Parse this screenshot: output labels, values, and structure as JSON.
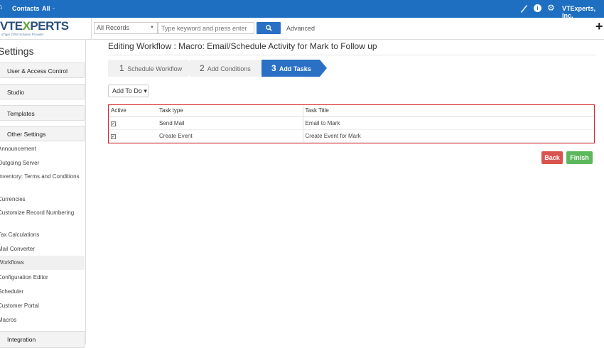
{
  "topbar": {
    "contacts": "Contacts",
    "all": "All",
    "org": "VTExperts, Inc."
  },
  "logo": {
    "brand_a": "VTE",
    "brand_x": "X",
    "brand_b": "PERTS",
    "tagline": "vTiger CRM Solution Provider"
  },
  "search": {
    "record_type": "All Records",
    "placeholder": "Type keyword and press enter",
    "advanced": "Advanced"
  },
  "sidebar": {
    "title": "Settings",
    "user_access": "User & Access Control",
    "studio": "Studio",
    "templates": "Templates",
    "other_settings": "Other Settings",
    "items": [
      "Announcement",
      "Outgoing Server",
      "Inventory: Terms and Conditions",
      "Currencies",
      "Customize Record Numbering",
      "Tax Calculations",
      "Mail Converter",
      "Workflows",
      "Configuration Editor",
      "Scheduler",
      "Customer Portal",
      "Macros"
    ],
    "integration": "Integration"
  },
  "main": {
    "page_title": "Editing Workflow : Macro: Email/Schedule Activity for Mark to Follow up",
    "steps": [
      {
        "num": "1",
        "label": "Schedule Workflow"
      },
      {
        "num": "2",
        "label": "Add Conditions"
      },
      {
        "num": "3",
        "label": "Add Tasks"
      }
    ],
    "add_to_do": "Add To Do",
    "table": {
      "headers": [
        "Active",
        "Task type",
        "Task Title"
      ],
      "rows": [
        {
          "active": true,
          "type": "Send Mail",
          "title": "Email to Mark"
        },
        {
          "active": true,
          "type": "Create Event",
          "title": "Create Event for Mark"
        }
      ]
    },
    "back": "Back",
    "finish": "Finish"
  },
  "colors": {
    "topbar": "#1e6fc1",
    "step_active": "#2a70c5",
    "highlight_border": "#d9262a",
    "back": "#d9534f",
    "finish": "#5cb85c"
  }
}
